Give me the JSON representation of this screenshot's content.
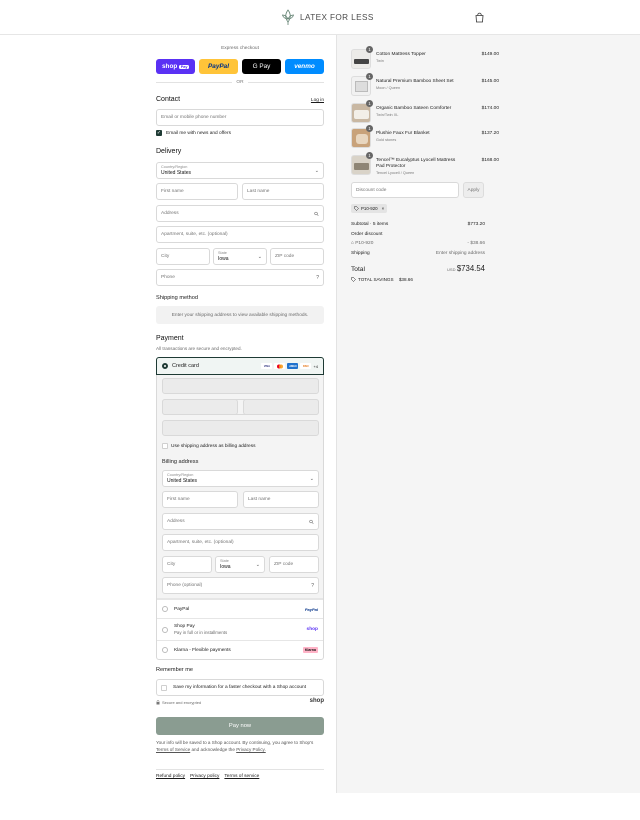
{
  "brand": {
    "name": "LATEX FOR LESS"
  },
  "express": {
    "title": "Express checkout",
    "or": "OR",
    "shop_label": "shop",
    "shop_tag": "Pay",
    "paypal": "PayPal",
    "gpay": "G Pay",
    "venmo": "venmo"
  },
  "contact": {
    "title": "Contact",
    "login": "Log in",
    "placeholder": "Email or mobile phone number",
    "newsletter": "Email me with news and offers"
  },
  "delivery": {
    "title": "Delivery",
    "country_label": "Country/Region",
    "country": "United States",
    "first": "First name",
    "last": "Last name",
    "address": "Address",
    "apt": "Apartment, suite, etc. (optional)",
    "city": "City",
    "state_label": "State",
    "state": "Iowa",
    "zip": "ZIP code",
    "phone": "Phone"
  },
  "shipping_method": {
    "title": "Shipping method",
    "notice": "Enter your shipping address to view available shipping methods."
  },
  "payment": {
    "title": "Payment",
    "subtitle": "All transactions are secure and encrypted.",
    "credit_card": "Credit card",
    "cards": [
      "VISA",
      "MC",
      "AMEX",
      "DISC"
    ],
    "more": "+4",
    "use_shipping": "Use shipping address as billing address",
    "billing_title": "Billing address",
    "billing_phone": "Phone (optional)",
    "options": [
      {
        "label": "PayPal",
        "brand": "PayPal",
        "sub": ""
      },
      {
        "label": "Shop Pay",
        "brand": "shop",
        "sub": "Pay in full or in installments"
      },
      {
        "label": "Klarna - Flexible payments",
        "brand": "Klarna",
        "sub": ""
      }
    ]
  },
  "remember": {
    "title": "Remember me",
    "save": "Save my information for a faster checkout with a Shop account",
    "secure": "Secure and encrypted",
    "shop": "shop"
  },
  "pay_now": "Pay now",
  "legal": {
    "line1": "Your info will be saved to a Shop account. By continuing, you agree to Shop's",
    "terms": "Terms of Service",
    "and": "and acknowledge the",
    "privacy": "Privacy Policy."
  },
  "footer_links": [
    "Refund policy",
    "Privacy policy",
    "Terms of service"
  ],
  "order": {
    "items": [
      {
        "qty": "1",
        "name": "Cotton Mattress Topper",
        "variant": "Twin",
        "price": "$149.00"
      },
      {
        "qty": "1",
        "name": "Natural Premium Bamboo Sheet Set",
        "variant": "Moon / Queen",
        "price": "$145.00"
      },
      {
        "qty": "1",
        "name": "Organic Bamboo Sateen Comforter",
        "variant": "Twin/Twin XL",
        "price": "$174.00"
      },
      {
        "qty": "1",
        "name": "Plushie Faux Fur Blanket",
        "variant": "Gold stones",
        "price": "$137.20"
      },
      {
        "qty": "1",
        "name": "Tencel™ Eucalyptus Lyocell Mattress Pad Protector",
        "variant": "Tencel Lyocell / Queen",
        "price": "$168.00"
      }
    ],
    "discount_placeholder": "Discount code",
    "apply": "Apply",
    "code": "P10-920",
    "subtotal_label": "Subtotal · 5 items",
    "subtotal": "$773.20",
    "order_discount": "Order discount",
    "discount_code": "P10-920",
    "discount_value": "- $38.66",
    "shipping_label": "Shipping",
    "shipping_value": "Enter shipping address",
    "total_label": "Total",
    "currency": "USD",
    "total": "$734.54",
    "savings_label": "TOTAL SAVINGS",
    "savings": "$38.66"
  }
}
